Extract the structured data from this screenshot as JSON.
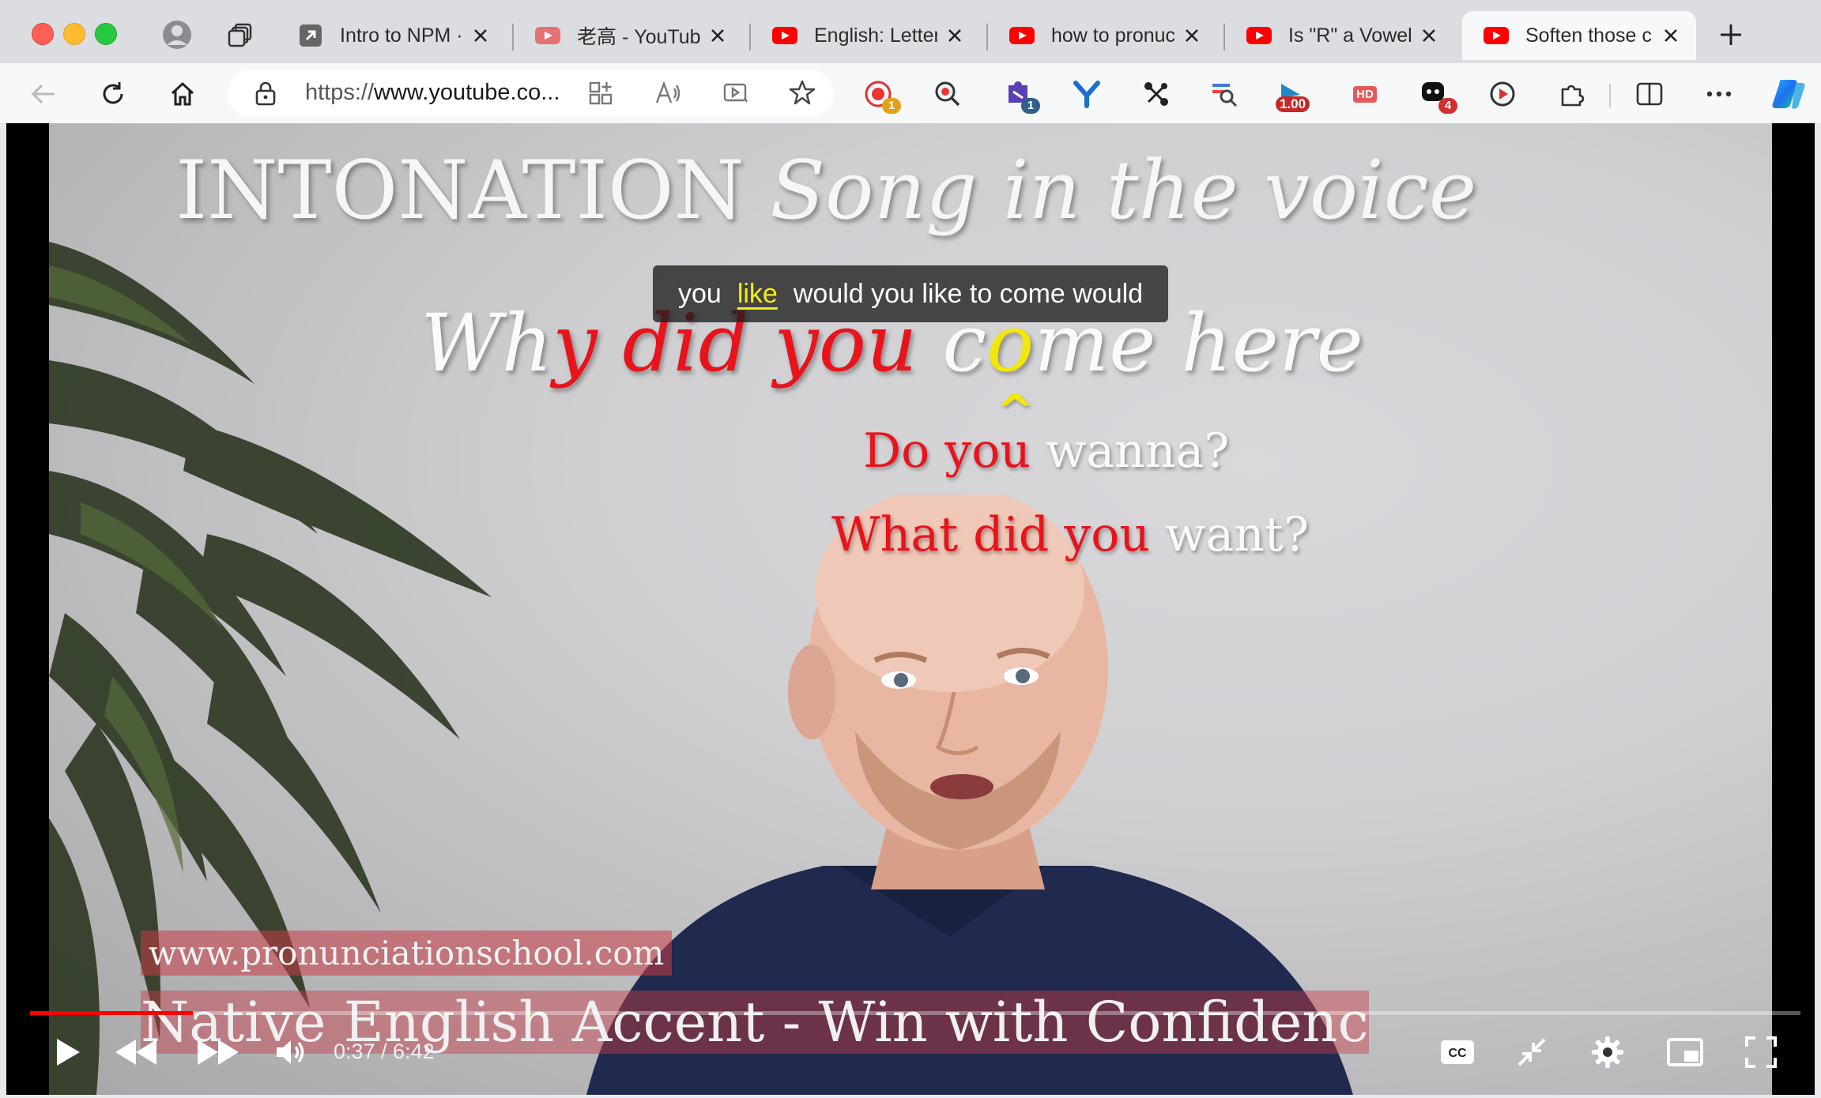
{
  "tabs": [
    {
      "title": "Intro to NPM ·",
      "favicon": "external-link-icon",
      "active": false
    },
    {
      "title": "老高 - YouTube",
      "favicon": "youtube-icon",
      "active": false
    },
    {
      "title": "English: Letters",
      "favicon": "youtube-icon",
      "active": false
    },
    {
      "title": "how to pronuce",
      "favicon": "youtube-icon",
      "active": false
    },
    {
      "title": "Is \"R\" a Vowel?",
      "favicon": "youtube-icon",
      "active": false
    },
    {
      "title": "Soften those c",
      "favicon": "youtube-icon",
      "active": true
    }
  ],
  "address": {
    "scheme": "https://",
    "host": "www.youtube.co..."
  },
  "extensions": {
    "badge_record": "1",
    "badge_puzzle": "1",
    "badge_speed": "1.00",
    "badge_hd": "HD",
    "badge_chat": "4"
  },
  "video": {
    "heading_main": "INTONATION",
    "heading_italic": "Song in the voice",
    "phrase_1": "Wh",
    "phrase_2": "y did you",
    "phrase_3": " c",
    "phrase_4": "o",
    "phrase_5": "me here",
    "caret": "^",
    "q1_red": "Do you",
    "q1_white": " wanna?",
    "q2_red": "What did you",
    "q2_white": " want?",
    "website": "www.pronunciationschool.com",
    "tagline": "Native English Accent - Win with Confidence"
  },
  "caption": {
    "word1": "you",
    "word2": "like",
    "word3": "would you like to come would"
  },
  "player": {
    "time": "0:37 / 6:42",
    "progress": 0.092
  },
  "colors": {
    "accent_red": "#ff0000",
    "caption_highlight": "#f2ee1a",
    "phrase_red": "#e8131b",
    "phrase_yellow": "#f2e70a"
  }
}
